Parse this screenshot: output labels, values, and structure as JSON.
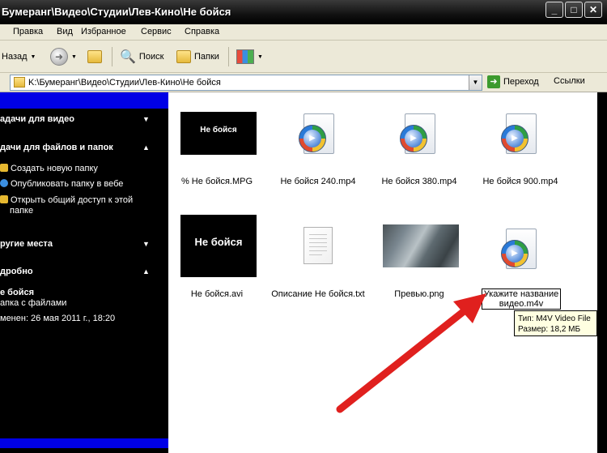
{
  "window": {
    "title": "Бумеранг\\Видео\\Студии\\Лев-Кино\\Не бойся",
    "controls": [
      "minimize",
      "maximize",
      "close"
    ]
  },
  "menu": [
    "Правка",
    "Вид",
    "Избранное",
    "Сервис",
    "Справка"
  ],
  "toolbar": {
    "back_label": "Назад",
    "search_label": "Поиск",
    "folders_label": "Папки"
  },
  "address": {
    "path": "K:\\Бумеранг\\Видео\\Студии\\Лев-Кино\\Не бойся",
    "go_label": "Переход",
    "links_label": "Ссылки"
  },
  "taskpane": {
    "video_tasks": "адачи для видео",
    "file_tasks": "дачи для файлов и папок",
    "file_task_items": [
      "Создать новую папку",
      "Опубликовать папку в вебе",
      "Открыть общий доступ к этой",
      "папке"
    ],
    "other_places": "ругие места",
    "details": "дробно",
    "details_name": "е бойся",
    "details_type": "апка с файлами",
    "details_modified": "менен: 26 мая 2011 г., 18:20"
  },
  "files": [
    {
      "name": "% Не бойся.MPG",
      "thumb_text": "Не бойся"
    },
    {
      "name": "Не бойся 240.mp4"
    },
    {
      "name": "Не бойся 380.mp4"
    },
    {
      "name": "Не бойся 900.mp4"
    },
    {
      "name": "Не бойся.avi",
      "thumb_text": "Не бойся"
    },
    {
      "name": "Описание Не бойся.txt"
    },
    {
      "name": "Превью.png"
    },
    {
      "name_line1": "Укажите название",
      "name_line2": "видео.m4v"
    }
  ],
  "tooltip": {
    "type": "Тип: M4V Video File",
    "size": "Размер: 18,2 МБ"
  },
  "colors": {
    "arrow": "#e0201e",
    "taskpane_accent": "#0000e6"
  }
}
